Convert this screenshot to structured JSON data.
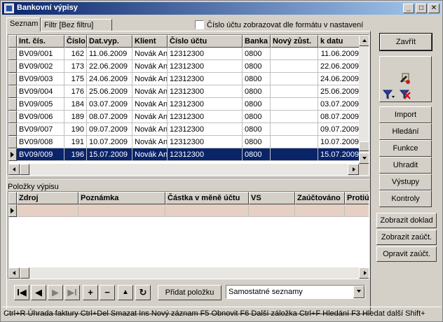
{
  "window": {
    "title": "Bankovní výpisy",
    "min_glyph": "_",
    "max_glyph": "□",
    "close_glyph": "✕"
  },
  "tabs": [
    {
      "label": "Seznam",
      "active": true
    },
    {
      "label": "Filtr [Bez filtru]",
      "active": false
    }
  ],
  "account_format_checkbox": {
    "label": "Číslo účtu zobrazovat dle formátu v nastavení",
    "checked": false
  },
  "statements_grid": {
    "columns": [
      "Int. čís.",
      "Číslo",
      "Dat.vyp.",
      "Klient",
      "Číslo účtu",
      "Banka",
      "Nový zůst.",
      "k datu"
    ],
    "rows": [
      [
        "BV09/001",
        "162",
        "11.06.2009",
        "Novák Ant",
        "12312300",
        "0800",
        "",
        "11.06.2009"
      ],
      [
        "BV09/002",
        "173",
        "22.06.2009",
        "Novák Ant",
        "12312300",
        "0800",
        "",
        "22.06.2009"
      ],
      [
        "BV09/003",
        "175",
        "24.06.2009",
        "Novák Ant",
        "12312300",
        "0800",
        "",
        "24.06.2009"
      ],
      [
        "BV09/004",
        "176",
        "25.06.2009",
        "Novák Ant",
        "12312300",
        "0800",
        "",
        "25.06.2009"
      ],
      [
        "BV09/005",
        "184",
        "03.07.2009",
        "Novák Ant",
        "12312300",
        "0800",
        "",
        "03.07.2009"
      ],
      [
        "BV09/006",
        "189",
        "08.07.2009",
        "Novák Ant",
        "12312300",
        "0800",
        "",
        "08.07.2009"
      ],
      [
        "BV09/007",
        "190",
        "09.07.2009",
        "Novák Ant",
        "12312300",
        "0800",
        "",
        "09.07.2009"
      ],
      [
        "BV09/008",
        "191",
        "10.07.2009",
        "Novák Ant",
        "12312300",
        "0800",
        "",
        "10.07.2009"
      ],
      [
        "BV09/009",
        "196",
        "15.07.2009",
        "Novák Ant",
        "12312300",
        "0800",
        "",
        "15.07.2009"
      ]
    ],
    "selected_row": 8
  },
  "items_group": {
    "label": "Položky výpisu",
    "columns": [
      "Zdroj",
      "Poznámka",
      "Částka v měně účtu",
      "VS",
      "Zaúčtováno",
      "Protiú"
    ]
  },
  "nav_bar": {
    "first": "I◀",
    "prev": "◀",
    "next": "▶",
    "last": "▶I",
    "add": "+",
    "remove": "−",
    "up": "▲",
    "refresh": "↻",
    "add_item_label": "Přidat položku",
    "list_mode_value": "Samostatné seznamy"
  },
  "sidebar": {
    "close": "Zavřít",
    "import": "Import",
    "search": "Hledání",
    "functions": "Funkce",
    "pay": "Uhradit",
    "outputs": "Výstupy",
    "checks": "Kontroly",
    "show_document": "Zobrazit doklad",
    "show_posting": "Zobrazit zaúčt.",
    "fix_posting": "Opravit zaúčt."
  },
  "statusbar": {
    "text": "Ctrl+R Úhrada faktury  Ctrl+Del Smazat  Ins Nový záznam  F5 Obnovit  F6 Další záložka  Ctrl+F Hledání  F3 Hledat další  Shift+"
  },
  "colors": {
    "title_start": "#0a246a",
    "title_end": "#a6caf0",
    "selection": "#0a246a",
    "items_row_bg": "#e6d0c4"
  }
}
